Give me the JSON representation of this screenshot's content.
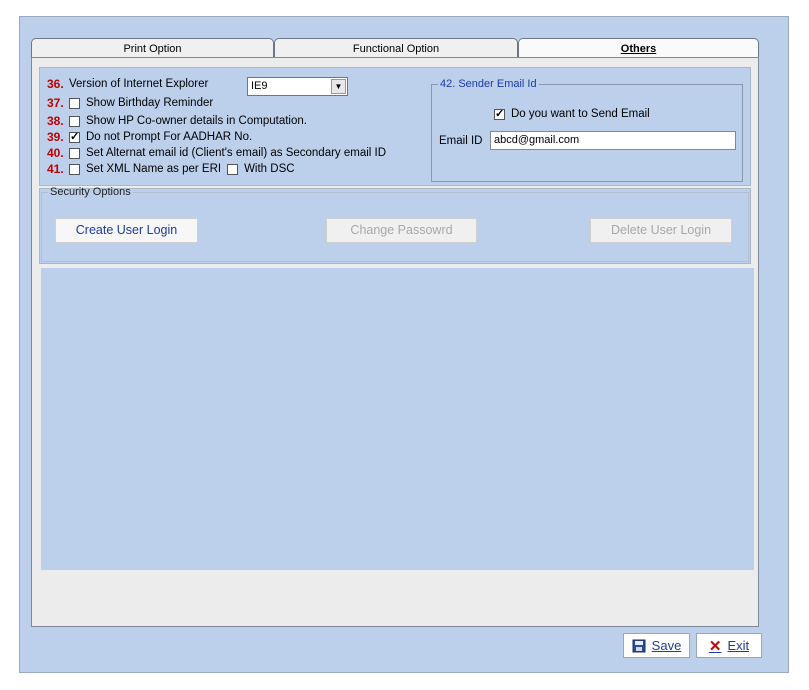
{
  "tabs": [
    {
      "label": "Print Option",
      "active": false
    },
    {
      "label": "Functional Option",
      "active": false
    },
    {
      "label": "Others",
      "active": true
    }
  ],
  "options": [
    {
      "num": "36.",
      "label": "Version of Internet Explorer",
      "type": "select"
    },
    {
      "num": "37.",
      "label": "Show Birthday Reminder",
      "checked": false
    },
    {
      "num": "38.",
      "label": "Show HP Co-owner details  in Computation.",
      "checked": false
    },
    {
      "num": "39.",
      "label": "Do not Prompt  For AADHAR No.",
      "checked": true
    },
    {
      "num": "40.",
      "label": "Set Alternat email id (Client's email) as Secondary email ID",
      "checked": false
    },
    {
      "num": "41.",
      "label": "Set XML Name as per ERI",
      "checked": false,
      "extra_label": "With DSC",
      "extra_checked": false
    }
  ],
  "ie_version": {
    "value": "IE9"
  },
  "sender_email": {
    "legend": "42. Sender Email Id",
    "send_label": "Do you want to Send Email",
    "send_checked": true,
    "email_label": "Email ID",
    "email_value": "abcd@gmail.com"
  },
  "security": {
    "legend": "Security Options",
    "create_label": "Create User Login",
    "change_label": "Change Passowrd",
    "delete_label": "Delete User Login"
  },
  "footer": {
    "save_label": "Save",
    "exit_label": "Exit"
  },
  "colors": {
    "number_red": "#c00000",
    "link_blue": "#1d3aa6",
    "panel_blue": "#bcd0ec"
  }
}
